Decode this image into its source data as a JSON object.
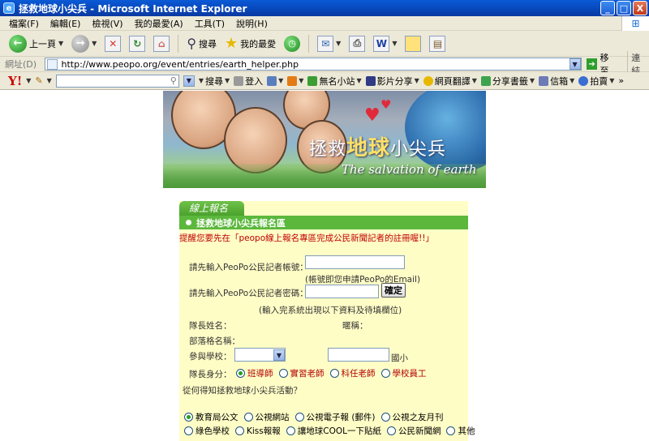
{
  "window": {
    "title": "拯救地球小尖兵 - Microsoft Internet Explorer",
    "app_icon": "ie-icon",
    "controls": {
      "minimize": "_",
      "maximize": "□",
      "close": "X"
    }
  },
  "menubar": {
    "items": [
      "檔案(F)",
      "編輯(E)",
      "檢視(V)",
      "我的最愛(A)",
      "工具(T)",
      "說明(H)"
    ]
  },
  "toolbar": {
    "back_label": "上一頁",
    "search_label": "搜尋",
    "favorites_label": "我的最愛"
  },
  "address_bar": {
    "label": "網址(D)",
    "url": "http://www.peopo.org/event/entries/earth_helper.php",
    "go_label": "移至",
    "links_label": "連結"
  },
  "yahoo_toolbar": {
    "logo": "Y!",
    "search_value": "",
    "search_label": "搜尋",
    "login_label": "登入",
    "items": [
      "無名小站",
      "影片分享",
      "網頁翻譯",
      "分享書籤",
      "信箱",
      "拍賣"
    ]
  },
  "banner": {
    "title_prefix": "拯救",
    "title_highlight": "地球",
    "title_suffix": "小尖兵",
    "subtitle": "The salvation of earth"
  },
  "form": {
    "tab_title": "線上報名",
    "section_title": "拯救地球小尖兵報名區",
    "reminder": "提醒您要先在「peopo線上報名專區完成公民新聞記者的註冊喔!!」",
    "account_label": "請先輸入PeoPo公民記者帳號：",
    "account_value": "",
    "account_hint": "(帳號即您申請PeoPo的Email)",
    "password_label": "請先輸入PeoPo公民記者密碼：",
    "password_value": "",
    "confirm_button": "確定",
    "after_confirm_hint": "(輸入完系統出現以下資料及待填欄位)",
    "leader_name_label": "隊長姓名：",
    "nickname_label": "暱稱：",
    "tribe_name_label": "部落格名稱：",
    "school_label": "參與學校：",
    "school_select_value": "",
    "school_name_value": "",
    "school_suffix": "國小",
    "identity_label": "隊長身分：",
    "identity_options": [
      {
        "label": "班導師",
        "checked": true
      },
      {
        "label": "實習老師",
        "checked": false
      },
      {
        "label": "科任老師",
        "checked": false
      },
      {
        "label": "學校員工",
        "checked": false
      }
    ],
    "source_question": "從何得知拯救地球小尖兵活動？",
    "source_options_row1": [
      {
        "label": "教育局公文",
        "checked": true
      },
      {
        "label": "公視網站",
        "checked": false
      },
      {
        "label": "公視電子報 (郵件)",
        "checked": false
      },
      {
        "label": "公視之友月刊",
        "checked": false
      }
    ],
    "source_options_row2": [
      {
        "label": "綠色學校",
        "checked": false
      },
      {
        "label": "Kiss報報",
        "checked": false
      },
      {
        "label": "讓地球COOL一下貼紙",
        "checked": false
      },
      {
        "label": "公民新聞網",
        "checked": false
      },
      {
        "label": "其他",
        "checked": false
      }
    ]
  }
}
